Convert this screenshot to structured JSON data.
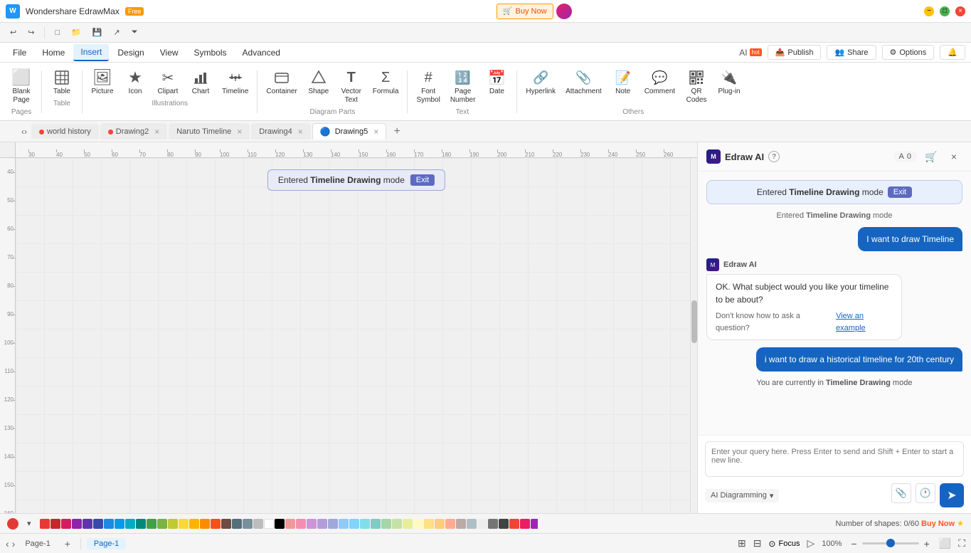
{
  "app": {
    "name": "Wondershare EdrawMax",
    "badge": "Free",
    "title": "Wondershare EdrawMax — Free"
  },
  "titlebar": {
    "buy_label": "Buy Now",
    "minimize": "−",
    "maximize": "□",
    "close": "×"
  },
  "toolbar": {
    "undo": "↩",
    "redo": "↪",
    "new": "□",
    "open": "📁",
    "save": "💾",
    "export": "↗",
    "history": "⏷"
  },
  "menu": {
    "items": [
      "File",
      "Home",
      "Insert",
      "Design",
      "View",
      "Symbols",
      "Advanced"
    ],
    "active": "Insert",
    "ai_label": "AI",
    "ai_hot": "hot",
    "publish": "Publish",
    "share": "Share",
    "options": "Options",
    "notifications": "🔔"
  },
  "ribbon": {
    "groups": [
      {
        "label": "Pages",
        "items": [
          {
            "icon": "page-icon",
            "label": "Blank\nPage",
            "unicode": "⬜"
          }
        ]
      },
      {
        "label": "Table",
        "items": [
          {
            "icon": "table-icon",
            "label": "Table",
            "unicode": "⊞"
          }
        ]
      },
      {
        "label": "Illustrations",
        "items": [
          {
            "icon": "picture-icon",
            "label": "Picture",
            "unicode": "🖼"
          },
          {
            "icon": "icon-icon",
            "label": "Icon",
            "unicode": "★"
          },
          {
            "icon": "clipart-icon",
            "label": "Clipart",
            "unicode": "✂"
          },
          {
            "icon": "chart-icon",
            "label": "Chart",
            "unicode": "📊"
          },
          {
            "icon": "timeline-icon",
            "label": "Timeline",
            "unicode": "📅"
          }
        ]
      },
      {
        "label": "Diagram Parts",
        "items": [
          {
            "icon": "container-icon",
            "label": "Container",
            "unicode": "⬡"
          },
          {
            "icon": "shape-icon",
            "label": "Shape",
            "unicode": "◇"
          },
          {
            "icon": "vector-text-icon",
            "label": "Vector\nText",
            "unicode": "T"
          },
          {
            "icon": "formula-icon",
            "label": "Formula",
            "unicode": "Σ"
          }
        ]
      },
      {
        "label": "Text",
        "items": [
          {
            "icon": "font-symbol-icon",
            "label": "Font\nSymbol",
            "unicode": "#"
          },
          {
            "icon": "page-number-icon",
            "label": "Page\nNumber",
            "unicode": "🔢"
          },
          {
            "icon": "date-icon",
            "label": "Date",
            "unicode": "📅"
          }
        ]
      },
      {
        "label": "Others",
        "items": [
          {
            "icon": "hyperlink-icon",
            "label": "Hyperlink",
            "unicode": "🔗"
          },
          {
            "icon": "attachment-icon",
            "label": "Attachment",
            "unicode": "📎"
          },
          {
            "icon": "note-icon",
            "label": "Note",
            "unicode": "📝"
          },
          {
            "icon": "comment-icon",
            "label": "Comment",
            "unicode": "💬"
          },
          {
            "icon": "qr-codes-icon",
            "label": "QR\nCodes",
            "unicode": "⊞"
          },
          {
            "icon": "plug-in-icon",
            "label": "Plug-in",
            "unicode": "🔌"
          }
        ]
      }
    ]
  },
  "tabs": [
    {
      "id": "world-history",
      "label": "world history",
      "dot_color": "#f44336",
      "closable": false
    },
    {
      "id": "drawing2",
      "label": "Drawing2",
      "dot_color": "#f44336",
      "closable": true
    },
    {
      "id": "naruto-timeline",
      "label": "Naruto Timeline",
      "dot_color": null,
      "closable": true
    },
    {
      "id": "drawing4",
      "label": "Drawing4",
      "dot_color": null,
      "closable": true
    },
    {
      "id": "drawing5",
      "label": "Drawing5",
      "dot_color": null,
      "closable": true,
      "active": true
    }
  ],
  "ruler": {
    "h_ticks": [
      "30",
      "40",
      "50",
      "60",
      "70",
      "80",
      "90",
      "100",
      "110",
      "120",
      "130",
      "140",
      "150",
      "160",
      "170",
      "180",
      "190",
      "200",
      "210",
      "220",
      "230",
      "240",
      "250",
      "260"
    ],
    "v_ticks": [
      "40",
      "50",
      "60",
      "70",
      "80",
      "90",
      "100",
      "110",
      "120",
      "130",
      "140",
      "150",
      "160"
    ]
  },
  "mode_banner": {
    "text": "Entered ",
    "bold": "Timeline Drawing",
    "text2": " mode",
    "exit_label": "Exit"
  },
  "ai_panel": {
    "title": "Edraw AI",
    "help_icon": "?",
    "counter": "0",
    "messages": [
      {
        "type": "notification",
        "text_pre": "Entered ",
        "bold": "Timeline Drawing",
        "text_post": " mode",
        "exit_label": "Exit"
      },
      {
        "type": "notification-small",
        "text": "Entered Timeline Drawing mode"
      },
      {
        "type": "user",
        "text": "I want to draw Timeline"
      },
      {
        "type": "assistant",
        "sender": "Edraw AI",
        "text": "OK. What subject would you like your timeline to be about?",
        "footer_text": "Don't know how to ask a question?",
        "footer_link": "View an example"
      },
      {
        "type": "user",
        "text": "i want to draw a historical timeline for 20th century"
      },
      {
        "type": "mode-notice",
        "text_pre": "You are currently in ",
        "bold": "Timeline Drawing",
        "text_post": " mode"
      }
    ],
    "input_placeholder": "Enter your query here. Press Enter to send and Shift + Enter to start a new line.",
    "mode_selector": "AI Diagramming",
    "send_icon": "➤"
  },
  "statusbar": {
    "colors": [
      "#e53935",
      "#e53935",
      "#d81b60",
      "#8e24aa",
      "#5e35b1",
      "#3949ab",
      "#1e88e5",
      "#039be5",
      "#00acc1",
      "#00897b",
      "#43a047",
      "#7cb342",
      "#c0ca33",
      "#fdd835",
      "#ffb300",
      "#fb8c00",
      "#f4511e",
      "#6d4c41",
      "#546e7a",
      "#78909c",
      "#bdbdbd",
      "#fff",
      "#000",
      "#f44336",
      "#e91e63",
      "#9c27b0",
      "#673ab7",
      "#3f51b5",
      "#2196f3",
      "#03a9f4",
      "#00bcd4",
      "#009688",
      "#4caf50",
      "#8bc34a",
      "#cddc39",
      "#ffeb3b",
      "#ffc107",
      "#ff9800",
      "#ff5722",
      "#795548",
      "#607d8b",
      "#9e9e9e",
      "#fff59d",
      "#ef9a9a",
      "#f48fb1",
      "#ce93d8",
      "#b39ddb",
      "#9fa8da",
      "#90caf9",
      "#81d4fa",
      "#80deea",
      "#80cbc4",
      "#a5d6a7",
      "#c5e1a5",
      "#e6ee9c",
      "#fff9c4",
      "#ffe082",
      "#ffcc80",
      "#ffab91",
      "#bcaaa4",
      "#b0bec5",
      "#eeeeee"
    ],
    "shapes_label": "Number of shapes: 0/60",
    "buy_now": "Buy Now",
    "page_label": "Page-1",
    "page_active": "Page-1",
    "zoom_percent": "100%",
    "focus_label": "Focus"
  }
}
